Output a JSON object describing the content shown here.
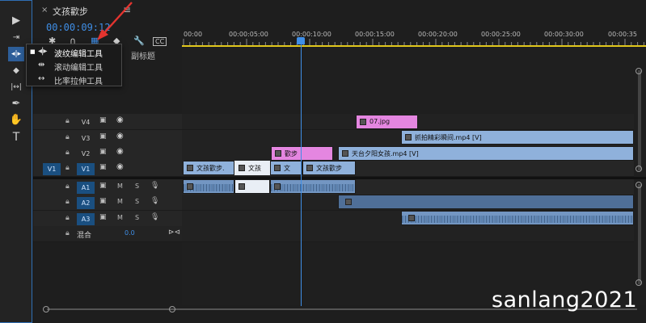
{
  "sequence": {
    "close": "×",
    "name": "文孩歡步",
    "menu": "≡",
    "timecode": "00:00:09:12"
  },
  "tools": [
    {
      "name": "selection-tool",
      "glyph": "▶"
    },
    {
      "name": "track-select-tool",
      "glyph": "⇥"
    },
    {
      "name": "ripple-edit-tool",
      "glyph": "◂|▸"
    },
    {
      "name": "razor-tool",
      "glyph": "◆"
    },
    {
      "name": "slip-tool",
      "glyph": "|↔|"
    },
    {
      "name": "pen-tool",
      "glyph": "✒"
    },
    {
      "name": "hand-tool",
      "glyph": "✋"
    },
    {
      "name": "type-tool",
      "glyph": "T"
    }
  ],
  "flyout": [
    {
      "icon": "◂|▸",
      "label": "波纹编辑工具",
      "bullet": "■"
    },
    {
      "icon": "⇹",
      "label": "滚动编辑工具",
      "bullet": ""
    },
    {
      "icon": "↔",
      "label": "比率拉伸工具",
      "bullet": ""
    }
  ],
  "subtitle_label": "副标题",
  "ruler": [
    "00:00",
    "00:00:05:00",
    "00:00:10:00",
    "00:00:15:00",
    "00:00:20:00",
    "00:00:25:00",
    "00:00:30:00",
    "00:00:35"
  ],
  "tracks": {
    "v4": {
      "label": "V4"
    },
    "v3": {
      "label": "V3"
    },
    "v2": {
      "label": "V2"
    },
    "v1": {
      "label": "V1",
      "source": "V1"
    },
    "a1": {
      "label": "A1",
      "m": "M",
      "s": "S"
    },
    "a2": {
      "label": "A2",
      "m": "M",
      "s": "S"
    },
    "a3": {
      "label": "A3",
      "m": "M",
      "s": "S"
    },
    "mix": {
      "label": "混合",
      "value": "0.0"
    }
  },
  "clips": {
    "v4_jpg": "07.jpg",
    "v3_mp4": "抓拍精彩瞬间.mp4 [V]",
    "v2_pink": "歡步",
    "v2_mp4": "天台夕阳女孩.mp4 [V]",
    "v1_a": "文孩歡步.",
    "v1_b": "文孩",
    "v1_c": "文",
    "v1_d": "文孩歡步"
  },
  "watermark": "sanlang2021"
}
